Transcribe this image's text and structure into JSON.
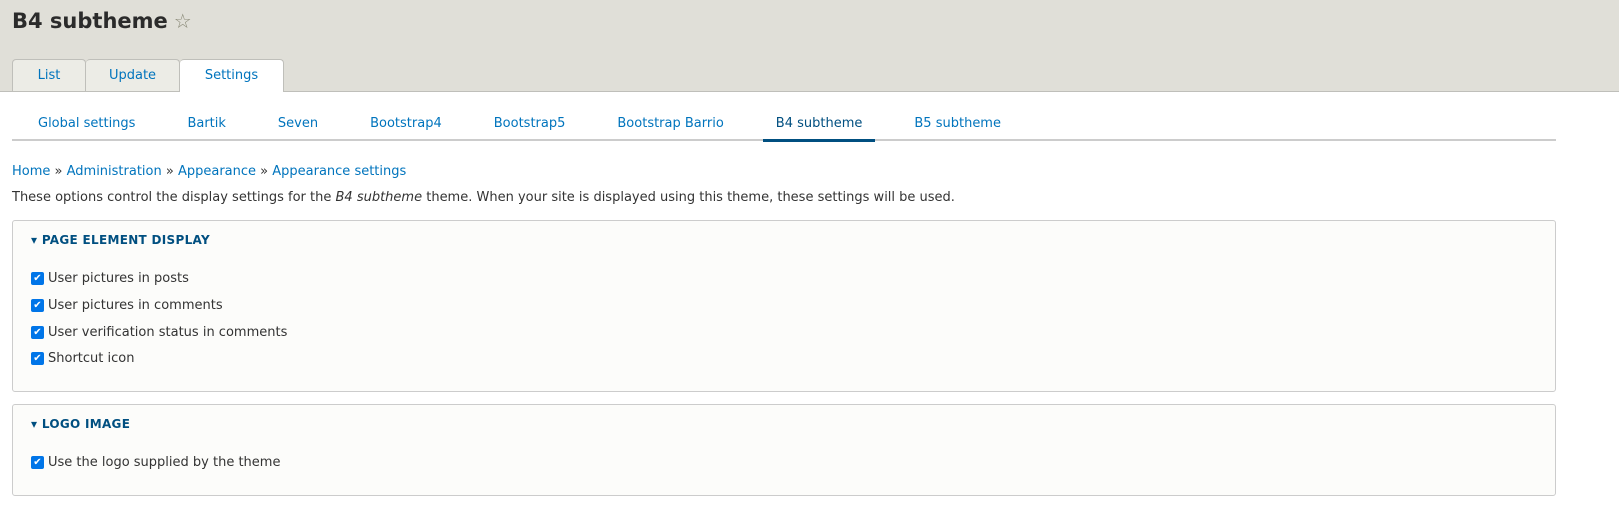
{
  "header": {
    "title": "B4 subtheme",
    "tabs": [
      {
        "label": "List"
      },
      {
        "label": "Update"
      },
      {
        "label": "Settings"
      }
    ]
  },
  "secondary_tabs": [
    "Global settings",
    "Bartik",
    "Seven",
    "Bootstrap4",
    "Bootstrap5",
    "Bootstrap Barrio",
    "B4 subtheme",
    "B5 subtheme"
  ],
  "breadcrumb": [
    "Home",
    "Administration",
    "Appearance",
    "Appearance settings"
  ],
  "description": {
    "before": "These options control the display settings for the ",
    "theme": "B4 subtheme",
    "after": " theme. When your site is displayed using this theme, these settings will be used."
  },
  "page_element_display": {
    "legend": "PAGE ELEMENT DISPLAY",
    "items": [
      {
        "label": "User pictures in posts",
        "checked": true
      },
      {
        "label": "User pictures in comments",
        "checked": true
      },
      {
        "label": "User verification status in comments",
        "checked": true
      },
      {
        "label": "Shortcut icon",
        "checked": true
      }
    ]
  },
  "logo_image": {
    "legend": "LOGO IMAGE",
    "items": [
      {
        "label": "Use the logo supplied by the theme",
        "checked": true
      }
    ]
  }
}
